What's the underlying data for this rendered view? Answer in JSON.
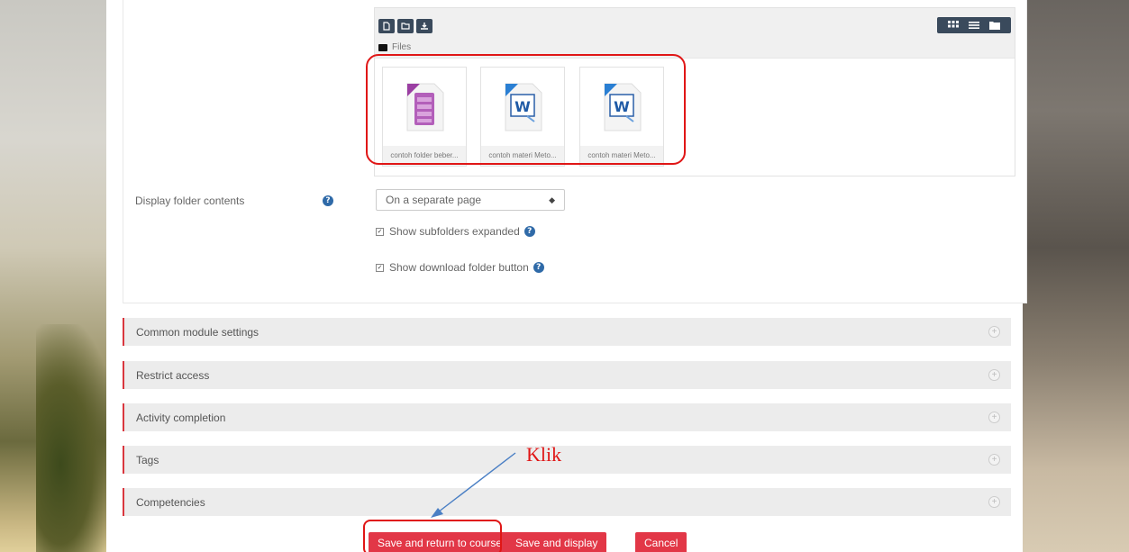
{
  "file_manager": {
    "path_label": "Files",
    "files": [
      {
        "name": "contoh folder beber...",
        "type": "archive"
      },
      {
        "name": "contoh materi Meto...",
        "type": "word"
      },
      {
        "name": "contoh materi Meto...",
        "type": "word"
      }
    ]
  },
  "settings": {
    "display_label": "Display folder contents",
    "display_value": "On a separate page",
    "show_subfolders_label": "Show subfolders expanded",
    "show_download_label": "Show download folder button"
  },
  "sections": [
    "Common module settings",
    "Restrict access",
    "Activity completion",
    "Tags",
    "Competencies"
  ],
  "buttons": {
    "save_return": "Save and return to course",
    "save_display": "Save and display",
    "cancel": "Cancel"
  },
  "annotation": {
    "text": "Klik"
  },
  "colors": {
    "accent": "#e23747",
    "annotation": "#e01616",
    "toolbar_button": "#3a4a5c",
    "help_icon": "#2f6aa8"
  }
}
